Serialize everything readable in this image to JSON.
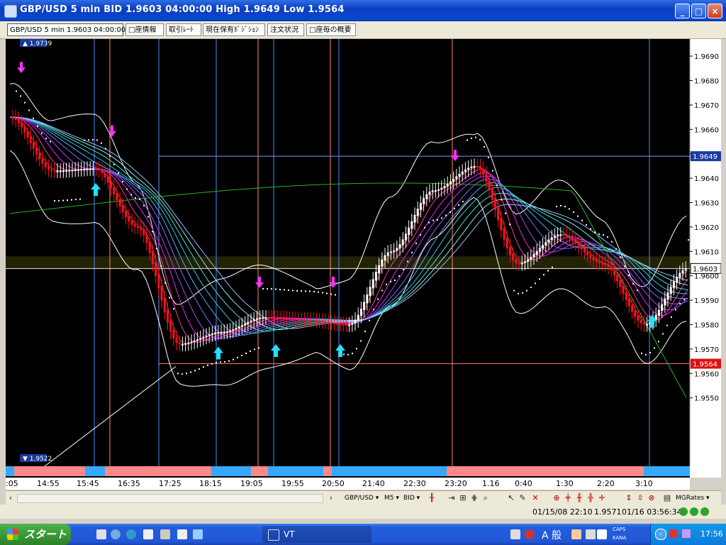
{
  "window": {
    "title": "GBP/USD 5 min BID 1.9603 04:00:00 High 1.9649 Low 1.9564",
    "buttons": {
      "minimize": "_",
      "maximize": "□",
      "close": "×"
    }
  },
  "tabs": [
    {
      "label": "GBP/USD 5 min 1.9603 04:00:00",
      "active": true
    },
    {
      "label": "□座情報",
      "active": false
    },
    {
      "label": "取引ﾚｰﾄ",
      "active": false
    },
    {
      "label": "現在保有ﾎﾟｼﾞｼｮﾝ",
      "active": false
    },
    {
      "label": "注文状況",
      "active": false
    },
    {
      "label": "□座毎の概要",
      "active": false
    }
  ],
  "chart": {
    "top_marker": "1.9739",
    "bottom_marker": "1.9522",
    "price_labels": [
      "1.9690",
      "1.9680",
      "1.9670",
      "1.9660",
      "1.9650",
      "1.9640",
      "1.9630",
      "1.9620",
      "1.9610",
      "1.9600",
      "1.9590",
      "1.9580",
      "1.9570",
      "1.9560",
      "1.9550"
    ],
    "high_label": "1.9649",
    "current_label": "1.9603",
    "low_label": "1.9564",
    "colors": {
      "background": "#000000",
      "bull": "#ffffff",
      "bear": "#ff1020",
      "signal_up": "#22e0ff",
      "signal_down": "#ff30ff",
      "ma_long": "#22b522",
      "band": "#ffffff"
    }
  },
  "chart_data": {
    "type": "line",
    "title": "GBP/USD 5 min BID 1.9603 04:00:00 High 1.9649 Low 1.9564",
    "xlabel": "",
    "ylabel": "",
    "x": [
      ":05",
      "14:55",
      "15:45",
      "16:35",
      "17:25",
      "18:15",
      "19:05",
      "19:55",
      "20:50",
      "21:40",
      "22:30",
      "23:20",
      "1.16",
      "0:40",
      "1:30",
      "2:20",
      "3:10"
    ],
    "ylim": [
      1.955,
      1.9695
    ],
    "series": [
      {
        "values": [
          1.9665,
          1.9643,
          1.9644,
          1.962,
          1.9572,
          1.9577,
          1.9583,
          1.9582,
          1.958,
          1.961,
          1.9635,
          1.9645,
          1.9605,
          1.9617,
          1.9605,
          1.958,
          1.9603
        ]
      }
    ],
    "high": 1.9649,
    "low": 1.9564,
    "last": 1.9603
  },
  "time_axis": [
    {
      "label": ":05",
      "x": 0
    },
    {
      "label": "14:55",
      "x": 44
    },
    {
      "label": "15:45",
      "x": 100
    },
    {
      "label": "16:35",
      "x": 158
    },
    {
      "label": "17:25",
      "x": 216
    },
    {
      "label": "18:15",
      "x": 273
    },
    {
      "label": "19:05",
      "x": 331
    },
    {
      "label": "19:55",
      "x": 389
    },
    {
      "label": "20:50",
      "x": 446
    },
    {
      "label": "21:40",
      "x": 503
    },
    {
      "label": "22:30",
      "x": 561
    },
    {
      "label": "23:20",
      "x": 619
    },
    {
      "label": "1.16",
      "x": 672
    },
    {
      "label": "0:40",
      "x": 718
    },
    {
      "label": "1:30",
      "x": 776
    },
    {
      "label": "2:20",
      "x": 834
    },
    {
      "label": "3:10",
      "x": 888
    }
  ],
  "toolbar": {
    "symbol": "GBP/USD",
    "timeframe": "M5",
    "price_type": "BID",
    "indicator": "MGRates"
  },
  "status": {
    "left_date": "01/15/08 22:10",
    "value": "1.9571",
    "right_date": "01/16 03:56:34"
  },
  "taskbar": {
    "start_label": "スタート",
    "task_label": "VT",
    "ime_label": "A 般",
    "clock": "17:56",
    "caps": "CAPS",
    "kana": "KANA"
  }
}
